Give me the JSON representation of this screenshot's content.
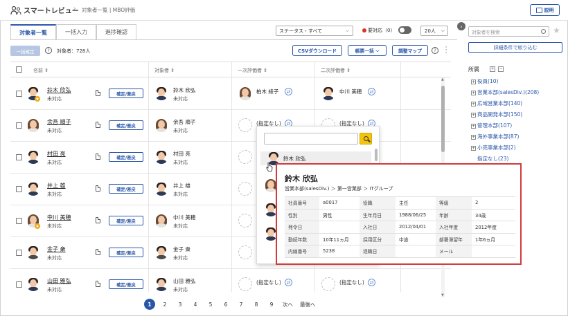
{
  "header": {
    "app_title": "スマートレビュー",
    "breadcrumb": "対象者一覧 | MBO評価",
    "help_label": "説明"
  },
  "tabs": [
    "対象者一覧",
    "一括入力",
    "進捗確認"
  ],
  "filters": {
    "status": "ステータス・すべて",
    "pending_label": "要対応（0）",
    "per_page": "20人"
  },
  "toolbar": {
    "bulk_confirm": "一括確定",
    "count_label": "対象者：728人",
    "csv_download": "CSVダウンロード",
    "form_bulk": "帳票一括",
    "adjust_map": "調整マップ"
  },
  "table": {
    "headers": [
      "名前",
      "対象者",
      "一次評価者",
      "二次評価者"
    ],
    "confirm_label": "確定/差戻",
    "unassigned_label": "(指定なし)",
    "rows": [
      {
        "name": "鈴木 欣弘",
        "status": "未対応",
        "target": "鈴木 欣弘",
        "target_status": "未対応",
        "first": "柏木 綾子",
        "second": "中川 美穂"
      },
      {
        "name": "余吾 順子",
        "status": "未対応",
        "target": "余吾 順子",
        "target_status": "未対応",
        "first": "(指定なし)",
        "second": "(指定なし)"
      },
      {
        "name": "村田 亮",
        "status": "未対応",
        "target": "村田 亮",
        "target_status": "未対応",
        "first": "",
        "second": ""
      },
      {
        "name": "井上 雄",
        "status": "未対応",
        "target": "井上 雄",
        "target_status": "未対応",
        "first": "",
        "second": ""
      },
      {
        "name": "中川 美穂",
        "status": "未対応",
        "target": "中川 美穂",
        "target_status": "未対応",
        "first": "",
        "second": ""
      },
      {
        "name": "金子 衆",
        "status": "未対応",
        "target": "金子 衆",
        "target_status": "未対応",
        "first": "",
        "second": ""
      },
      {
        "name": "山田 雅弘",
        "status": "未対応",
        "target": "山田 雅弘",
        "target_status": "未対応",
        "first": "(指定なし)",
        "second": "(指定なし)"
      }
    ]
  },
  "pagination": {
    "pages": [
      "1",
      "2",
      "3",
      "4",
      "5",
      "6",
      "7",
      "8",
      "9"
    ],
    "next": "次へ",
    "last": "最後へ",
    "current": "1"
  },
  "dropdown": {
    "highlighted": "鈴木 欣弘"
  },
  "card": {
    "name": "鈴木 欣弘",
    "dept": "営業本部(salesDiv.)  ＞  第一営業部  ＞  ITグループ",
    "rows": [
      [
        "社員番号",
        "a0017",
        "役職",
        "主任",
        "等級",
        "2"
      ],
      [
        "性別",
        "男性",
        "生年月日",
        "1988/06/25",
        "年齢",
        "34歳"
      ],
      [
        "発令日",
        "",
        "入社日",
        "2012/04/01",
        "入社年度",
        "2012年度"
      ],
      [
        "勤続年数",
        "10年11ヵ月",
        "採用区分",
        "中途",
        "部署滞留年",
        "1年6ヵ月"
      ],
      [
        "内線番号",
        "5238",
        "退職日",
        "",
        "メール",
        ""
      ]
    ]
  },
  "right_panel": {
    "search_placeholder": "対象者を検索",
    "detail_filter": "詳細条件で絞り込む",
    "section_title": "所属",
    "tree": [
      "役員(10)",
      "営業本部(salesDiv.)(208)",
      "広域営業本部(140)",
      "商品開発本部(150)",
      "管理本部(107)",
      "海外事業本部(87)",
      "小売事業本部(2)"
    ],
    "tree_leaf": "指定なし(23)"
  }
}
